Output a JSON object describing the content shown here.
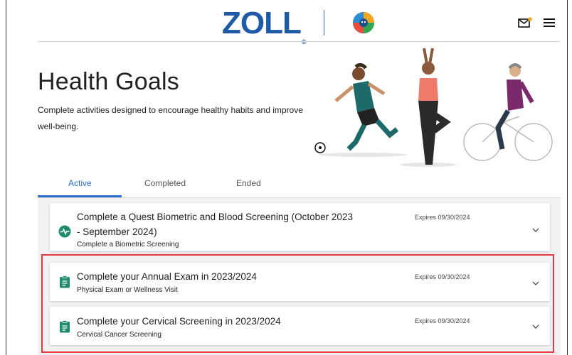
{
  "header": {
    "logo_text": "ZOLL",
    "logo_mark": "®",
    "icons": [
      "health-badge-icon",
      "mail-icon",
      "menu-icon"
    ],
    "brand_color": "#1f5aa8",
    "notification_color": "#f5a623"
  },
  "page": {
    "title": "Health Goals",
    "description": "Complete activities designed to encourage healthy habits and improve well-being."
  },
  "tabs": [
    {
      "label": "Active",
      "active": true
    },
    {
      "label": "Completed",
      "active": false
    },
    {
      "label": "Ended",
      "active": false
    }
  ],
  "goals": [
    {
      "title_line1": "Complete a Quest Biometric and Blood Screening (October 2023",
      "title_line2": "- September 2024)",
      "subtitle": "Complete a Biometric Screening",
      "expires": "Expires 09/30/2024",
      "icon": "heartbeat-icon"
    },
    {
      "title_line1": "Complete your Annual Exam in 2023/2024",
      "subtitle": "Physical Exam or Wellness Visit",
      "expires": "Expires 09/30/2024",
      "icon": "clipboard-icon"
    },
    {
      "title_line1": "Complete your Cervical Screening in 2023/2024",
      "subtitle": "Cervical Cancer Screening",
      "expires": "Expires 09/30/2024",
      "icon": "clipboard-icon"
    }
  ],
  "colors": {
    "accent": "#2a6fc9",
    "goal_icon": "#1e8a6e",
    "highlight": "#e0393e"
  }
}
